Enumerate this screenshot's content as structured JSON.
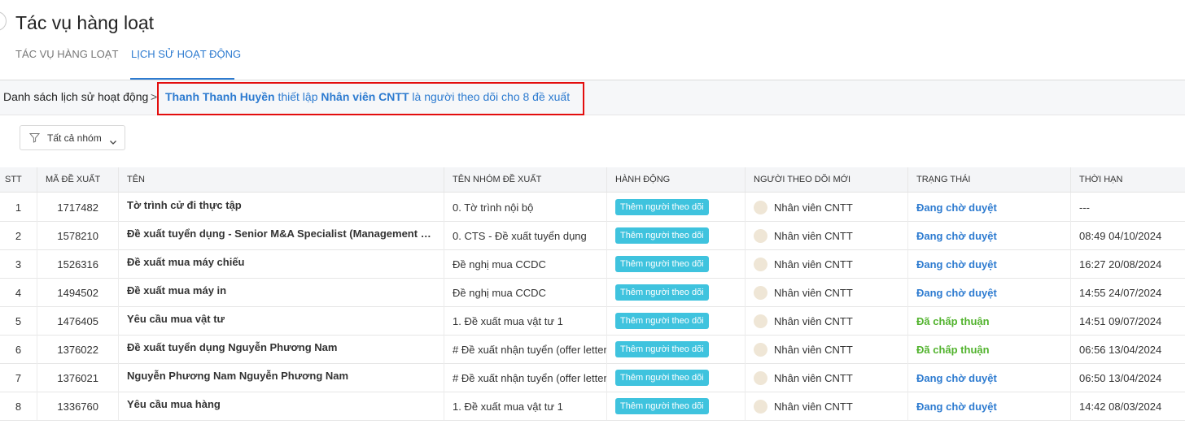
{
  "page": {
    "title": "Tác vụ hàng loạt",
    "tabs": [
      {
        "label": "TÁC VỤ HÀNG LOẠT",
        "active": false
      },
      {
        "label": "LỊCH SỬ HOẠT ĐỘNG",
        "active": true
      }
    ]
  },
  "breadcrumb": {
    "root": "Danh sách lịch sử hoạt động",
    "separator": ">",
    "actor": "Thanh Thanh Huyền",
    "verb": " thiết lập ",
    "target": "Nhân viên CNTT",
    "rest": " là người theo dõi cho 8 đề xuất"
  },
  "filter": {
    "label": "Tất cả nhóm",
    "icon": "filter-icon"
  },
  "table": {
    "headers": [
      "STT",
      "MÃ ĐỀ XUẤT",
      "TÊN",
      "TÊN NHÓM ĐỀ XUẤT",
      "HÀNH ĐỘNG",
      "NGƯỜI THEO DÕI MỚI",
      "TRẠNG THÁI",
      "THỜI HẠN"
    ],
    "rows": [
      {
        "stt": "1",
        "code": "1717482",
        "name": "Tờ trình cử đi thực tập",
        "group": "0. Tờ trình nội bộ",
        "action": "Thêm người theo dõi",
        "follower": "Nhân viên CNTT",
        "status": "Đang chờ duyệt",
        "status_type": "pending",
        "deadline": "---"
      },
      {
        "stt": "2",
        "code": "1578210",
        "name": "Đề xuất tuyển dụng - Senior M&A Specialist (Management Consulting)",
        "group": "0. CTS - Đề xuất tuyển dụng",
        "action": "Thêm người theo dõi",
        "follower": "Nhân viên CNTT",
        "status": "Đang chờ duyệt",
        "status_type": "pending",
        "deadline": "08:49 04/10/2024"
      },
      {
        "stt": "3",
        "code": "1526316",
        "name": "Đề xuất mua máy chiếu",
        "group": "Đề nghị mua CCDC",
        "action": "Thêm người theo dõi",
        "follower": "Nhân viên CNTT",
        "status": "Đang chờ duyệt",
        "status_type": "pending",
        "deadline": "16:27 20/08/2024"
      },
      {
        "stt": "4",
        "code": "1494502",
        "name": "Đề xuất mua máy in",
        "group": "Đề nghị mua CCDC",
        "action": "Thêm người theo dõi",
        "follower": "Nhân viên CNTT",
        "status": "Đang chờ duyệt",
        "status_type": "pending",
        "deadline": "14:55 24/07/2024"
      },
      {
        "stt": "5",
        "code": "1476405",
        "name": "Yêu cầu mua vật tư",
        "group": "1. Đề xuất mua vật tư 1",
        "action": "Thêm người theo dõi",
        "follower": "Nhân viên CNTT",
        "status": "Đã chấp thuận",
        "status_type": "approved",
        "deadline": "14:51 09/07/2024"
      },
      {
        "stt": "6",
        "code": "1376022",
        "name": "Đề xuất tuyển dụng Nguyễn Phương Nam",
        "group": "# Đề xuất nhận tuyển (offer letter)",
        "action": "Thêm người theo dõi",
        "follower": "Nhân viên CNTT",
        "status": "Đã chấp thuận",
        "status_type": "approved",
        "deadline": "06:56 13/04/2024"
      },
      {
        "stt": "7",
        "code": "1376021",
        "name": "Nguyễn Phương Nam Nguyễn Phương Nam",
        "group": "# Đề xuất nhận tuyển (offer letter)",
        "action": "Thêm người theo dõi",
        "follower": "Nhân viên CNTT",
        "status": "Đang chờ duyệt",
        "status_type": "pending",
        "deadline": "06:50 13/04/2024"
      },
      {
        "stt": "8",
        "code": "1336760",
        "name": "Yêu cầu mua hàng",
        "group": "1. Đề xuất mua vật tư 1",
        "action": "Thêm người theo dõi",
        "follower": "Nhân viên CNTT",
        "status": "Đang chờ duyệt",
        "status_type": "pending",
        "deadline": "14:42 08/03/2024"
      }
    ]
  },
  "colors": {
    "accent": "#2d7bd0",
    "badge": "#3fc3de",
    "approved": "#52b32e",
    "highlight": "#e30d0d"
  }
}
